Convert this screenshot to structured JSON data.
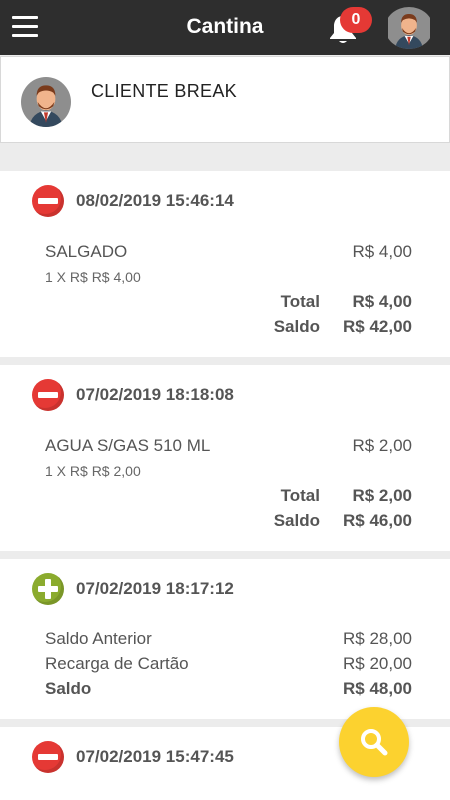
{
  "header": {
    "title": "Cantina",
    "notification_count": "0",
    "menu_icon": "hamburger-menu-icon",
    "bell_icon": "bell-icon"
  },
  "profile": {
    "name": "CLIENTE BREAK"
  },
  "transactions": [
    {
      "type": "debit",
      "icon": "minus-circle-icon",
      "datetime": "08/02/2019 15:46:14",
      "item": "SALGADO",
      "item_price": "R$ 4,00",
      "qty_line": "1 X R$ R$ 4,00",
      "total_label": "Total",
      "total_value": "R$ 4,00",
      "balance_label": "Saldo",
      "balance_value": "R$ 42,00"
    },
    {
      "type": "debit",
      "icon": "minus-circle-icon",
      "datetime": "07/02/2019 18:18:08",
      "item": "AGUA S/GAS 510 ML",
      "item_price": "R$ 2,00",
      "qty_line": "1 X R$ R$ 2,00",
      "total_label": "Total",
      "total_value": "R$ 2,00",
      "balance_label": "Saldo",
      "balance_value": "R$ 46,00"
    },
    {
      "type": "credit",
      "icon": "plus-circle-icon",
      "datetime": "07/02/2019 18:17:12",
      "prev_label": "Saldo Anterior",
      "prev_value": "R$ 28,00",
      "recharge_label": "Recarga de Cartão",
      "recharge_value": "R$ 20,00",
      "balance_label": "Saldo",
      "balance_value": "R$ 48,00"
    },
    {
      "type": "debit",
      "icon": "minus-circle-icon",
      "datetime": "07/02/2019 15:47:45"
    }
  ],
  "colors": {
    "topbar": "#2e2e2e",
    "debit": "#e53935",
    "credit": "#8bab2e",
    "fab": "#fcd22f",
    "badge": "#e53935"
  },
  "fab": {
    "icon": "search-icon"
  }
}
